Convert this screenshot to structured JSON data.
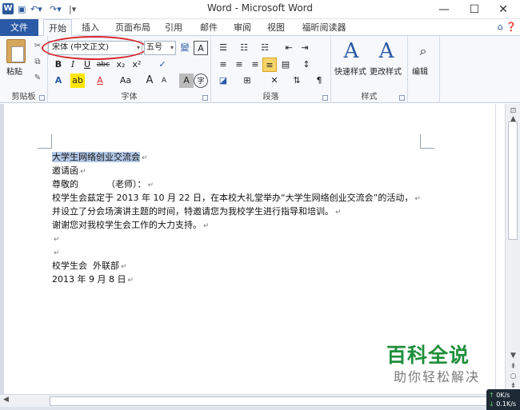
{
  "window": {
    "title": "Word - Microsoft Word",
    "app_icon": "W",
    "minimize": "—",
    "maximize": "☐",
    "close": "✕"
  },
  "quick_access": {
    "save_icon": "save-icon",
    "undo_icon": "undo-icon",
    "redo_icon": "redo-icon",
    "customize_icon": "customize-icon"
  },
  "tabs": {
    "file": "文件",
    "items": [
      "开始",
      "插入",
      "页面布局",
      "引用",
      "邮件",
      "审阅",
      "视图",
      "福昕阅读器"
    ],
    "active": "开始"
  },
  "ribbon": {
    "clipboard": {
      "paste": "粘贴",
      "label": "剪贴板"
    },
    "font": {
      "font_name": "宋体 (中文正文)",
      "font_size": "五号",
      "label": "字体",
      "bold": "B",
      "italic": "I",
      "underline": "U",
      "strike": "abc",
      "subscript": "x₂",
      "superscript": "x²",
      "case": "Aa",
      "grow": "A",
      "shrink": "A",
      "clear": "A",
      "highlight": "ab",
      "font_color": "A",
      "char_shading": "A",
      "enclose": "字",
      "phonetic": "變",
      "border": "A"
    },
    "paragraph": {
      "label": "段落"
    },
    "styles": {
      "quick": "快速样式",
      "change": "更改样式",
      "label": "样式"
    },
    "editing": {
      "label": "编辑"
    },
    "accent_color": "#2a5aa6",
    "highlight_color": "#d8262b"
  },
  "document": {
    "lines": [
      "大学生网络创业交流会",
      "邀请函",
      "尊敬的          （老师）：",
      "校学生会兹定于 2013 年 10 月 22 日，在本校大礼堂举办“大学生网络创业交流会”的活动，",
      "并设立了分会场演讲主题的时间，特邀请您为我校学生进行指导和培训。",
      "谢谢您对我校学生会工作的大力支持。",
      "",
      "",
      "校学生会  外联部",
      "2013 年 9 月 8 日"
    ],
    "paragraph_mark": "↵",
    "selected_line": 0
  },
  "watermark": {
    "big": "百科全说",
    "small": "助你轻松解决"
  },
  "network_widget": {
    "up": "0K/s",
    "down": "0.1K/s"
  }
}
